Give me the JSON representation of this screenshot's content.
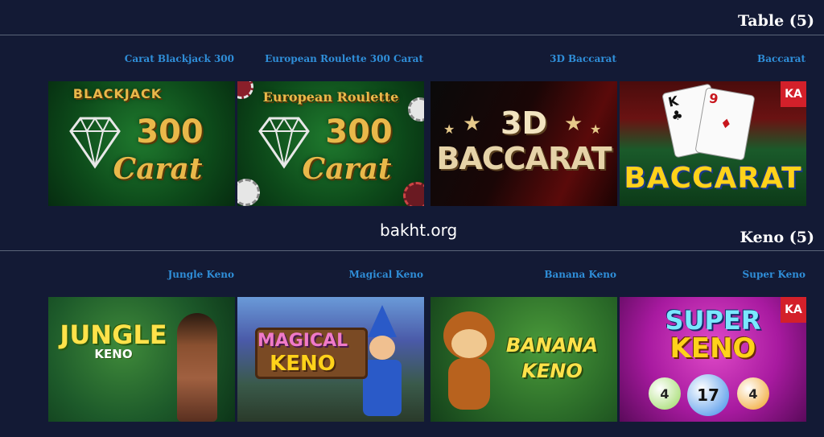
{
  "sections": [
    {
      "title": "Table (5)",
      "games": [
        {
          "label": "Carat Blackjack 300",
          "art_top": "BLACKJACK",
          "art_mid": "300",
          "art_bottom": "Carat"
        },
        {
          "label": "European Roulette 300 Carat",
          "art_top": "European Roulette",
          "art_mid": "300",
          "art_bottom": "Carat"
        },
        {
          "label": "3D Baccarat",
          "art_top": "3D",
          "art_bottom": "BACCARAT"
        },
        {
          "label": "Baccarat",
          "art_bottom": "BACCARAT",
          "badge": "KA"
        }
      ]
    },
    {
      "title": "Keno (5)",
      "games": [
        {
          "label": "Jungle Keno",
          "art_top": "JUNGLE",
          "art_bottom": "KENO"
        },
        {
          "label": "Magical Keno",
          "art_top": "MAGICAL",
          "art_bottom": "KENO"
        },
        {
          "label": "Banana Keno",
          "art_top": "BANANA",
          "art_bottom": "KENO"
        },
        {
          "label": "Super Keno",
          "art_top": "SUPER",
          "art_bottom": "KENO",
          "badge": "KA",
          "balls": [
            "4",
            "17",
            "4"
          ]
        }
      ]
    }
  ],
  "watermark": "bakht.org",
  "colors": {
    "background": "#131a35",
    "label": "#2f8ed8",
    "title": "#ffffff",
    "rule": "#5a6478"
  }
}
